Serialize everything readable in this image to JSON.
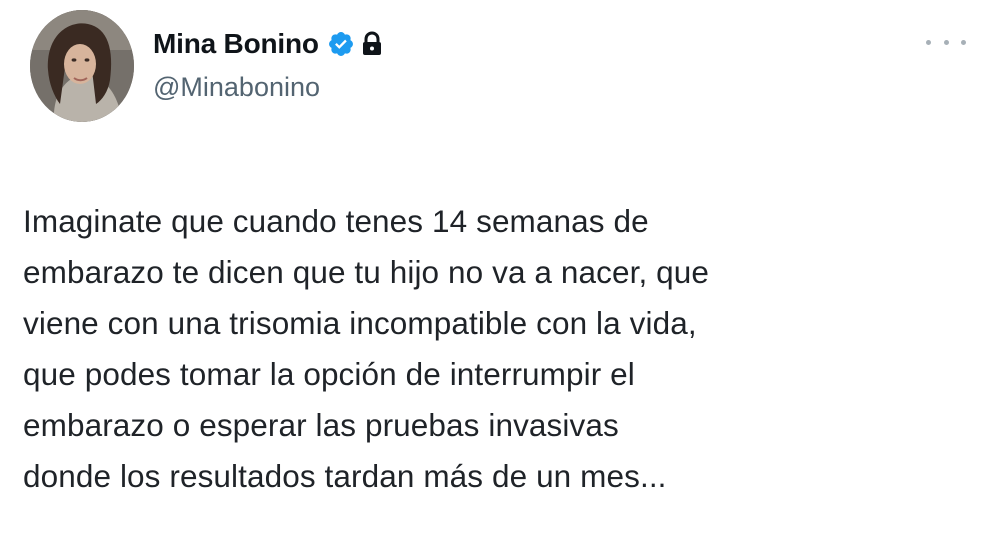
{
  "author": {
    "display_name": "Mina Bonino",
    "handle": "@Minabonino",
    "verified": true,
    "protected": true,
    "avatar_icon": "profile-photo"
  },
  "tweet": {
    "text_lines": [
      "Imaginate que cuando tenes 14 semanas de",
      "embarazo te dicen que tu hijo no va a nacer, que",
      "viene con una trisomia incompatible con la vida,",
      "que podes tomar la opción de interrumpir el",
      "embarazo o esperar las pruebas invasivas",
      "donde los resultados tardan más de un mes..."
    ]
  },
  "icons": {
    "verified": "verified-badge-icon",
    "lock": "lock-icon",
    "more": "more-options-icon"
  },
  "colors": {
    "verified_blue": "#1d9bf0",
    "text": "#0f1419",
    "secondary_text": "#536471"
  }
}
